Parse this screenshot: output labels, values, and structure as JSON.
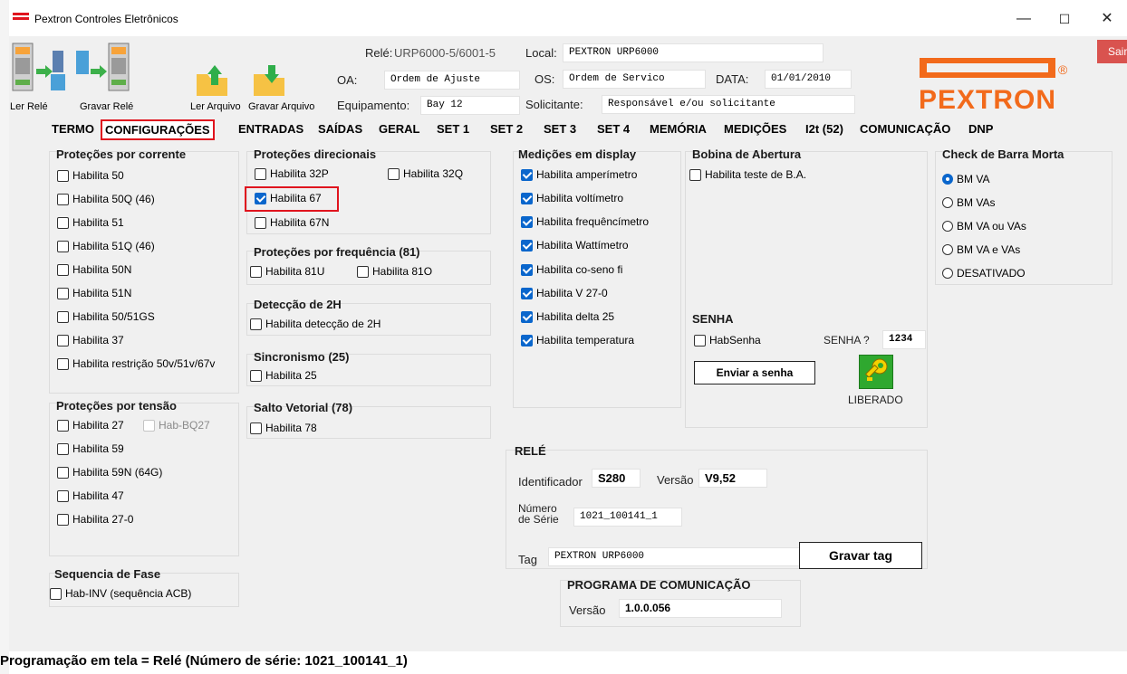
{
  "window": {
    "title": "Pextron Controles Eletrônicos",
    "minimize": "—",
    "maximize": "☐",
    "close": "✕"
  },
  "toolbar": {
    "ler_rele": "Ler Relé",
    "gravar_rele": "Gravar Relé",
    "ler_arquivo": "Ler Arquivo",
    "gravar_arquivo": "Gravar Arquivo",
    "sair": "Sair"
  },
  "header": {
    "rele_label": "Relé:",
    "rele_value": "URP6000-5/6001-5",
    "local_label": "Local:",
    "local_value": "PEXTRON URP6000",
    "oa_label": "OA:",
    "oa_value": "Ordem de Ajuste",
    "os_label": "OS:",
    "os_value": "Ordem de Servico",
    "data_label": "DATA:",
    "data_value": "01/01/2010",
    "equip_label": "Equipamento:",
    "equip_value": "Bay 12",
    "solic_label": "Solicitante:",
    "solic_value": "Responsável e/ou solicitante"
  },
  "logo": {
    "text": "PEXTRON",
    "mark": "®",
    "color": "#f26a1b"
  },
  "tabs": [
    "TERMO",
    "CONFIGURAÇÕES",
    "ENTRADAS",
    "SAÍDAS",
    "GERAL",
    "SET 1",
    "SET 2",
    "SET 3",
    "SET 4",
    "MEMÓRIA",
    "MEDIÇÕES",
    "I2t (52)",
    "COMUNICAÇÃO",
    "DNP"
  ],
  "groups": {
    "corrente": {
      "title": "Proteções por corrente",
      "items": [
        "Habilita 50",
        "Habilita 50Q (46)",
        "Habilita 51",
        "Habilita 51Q (46)",
        "Habilita 50N",
        "Habilita 51N",
        "Habilita 50/51GS",
        "Habilita 37",
        "Habilita restrição 50v/51v/67v"
      ]
    },
    "tensao": {
      "title": "Proteções por tensão",
      "items": [
        "Habilita 27",
        "Hab-BQ27",
        "Habilita 59",
        "Habilita 59N (64G)",
        "Habilita 47",
        "Habilita 27-0"
      ]
    },
    "sequencia": {
      "title": "Sequencia de Fase",
      "items": [
        "Hab-INV (sequência ACB)"
      ]
    },
    "direcionais": {
      "title": "Proteções direcionais",
      "items": [
        "Habilita 32P",
        "Habilita 32Q",
        "Habilita 67",
        "Habilita 67N"
      ]
    },
    "frequencia": {
      "title": "Proteções por frequência (81)",
      "items": [
        "Habilita 81U",
        "Habilita 81O"
      ]
    },
    "deteccao": {
      "title": "Detecção de 2H",
      "items": [
        "Habilita detecção de 2H"
      ]
    },
    "sincronismo": {
      "title": "Sincronismo (25)",
      "items": [
        "Habilita 25"
      ]
    },
    "salto": {
      "title": "Salto Vetorial (78)",
      "items": [
        "Habilita 78"
      ]
    },
    "medicoes": {
      "title": "Medições em display",
      "items": [
        "Habilita amperímetro",
        "Habilita voltímetro",
        "Habilita frequêncímetro",
        "Habilita Wattímetro",
        "Habilita co-seno fi",
        "Habilita V 27-0",
        "Habilita delta 25",
        "Habilita temperatura"
      ]
    },
    "bobina": {
      "title": "Bobina de Abertura",
      "items": [
        "Habilita teste de B.A."
      ]
    },
    "senha": {
      "title": "SENHA",
      "hab": "HabSenha",
      "label": "SENHA ?",
      "value": "1234",
      "button": "Enviar a senha",
      "status": "LIBERADO"
    },
    "barra": {
      "title": "Check de Barra Morta",
      "options": [
        "BM VA",
        "BM VAs",
        "BM VA ou VAs",
        "BM VA e VAs",
        "DESATIVADO"
      ],
      "selected": "BM VA"
    },
    "rele": {
      "title": "RELÉ",
      "id_label": "Identificador",
      "id_value": "S280",
      "ver_label": "Versão",
      "ver_value": "V9,52",
      "serie_label_1": "Número",
      "serie_label_2": "de Série",
      "serie_value": "1021_100141_1",
      "tag_label": "Tag",
      "tag_value": "PEXTRON URP6000",
      "tag_button": "Gravar tag"
    },
    "programa": {
      "title": "PROGRAMA DE COMUNICAÇÃO",
      "ver_label": "Versão",
      "ver_value": "1.0.0.056"
    }
  },
  "status": "Programação em tela = Relé (Número de série: 1021_100141_1)"
}
